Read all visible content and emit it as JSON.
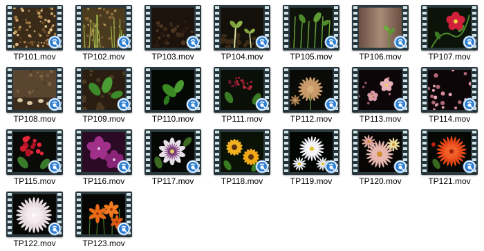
{
  "files": [
    {
      "name": "TP101.mov",
      "scene": "soil-seeds"
    },
    {
      "name": "TP102.mov",
      "scene": "sprouts-field"
    },
    {
      "name": "TP103.mov",
      "scene": "dark-soil"
    },
    {
      "name": "TP104.mov",
      "scene": "sprouts-dark"
    },
    {
      "name": "TP105.mov",
      "scene": "green-stems"
    },
    {
      "name": "TP106.mov",
      "scene": "bark-sprout"
    },
    {
      "name": "TP107.mov",
      "scene": "red-flower-vine"
    },
    {
      "name": "TP108.mov",
      "scene": "soil-mushrooms"
    },
    {
      "name": "TP109.mov",
      "scene": "leaves-soil"
    },
    {
      "name": "TP110.mov",
      "scene": "leaves-dark"
    },
    {
      "name": "TP111.mov",
      "scene": "raspberries"
    },
    {
      "name": "TP112.mov",
      "scene": "thistle-flower"
    },
    {
      "name": "TP113.mov",
      "scene": "pink-blossoms"
    },
    {
      "name": "TP114.mov",
      "scene": "pink-buds"
    },
    {
      "name": "TP115.mov",
      "scene": "red-geranium"
    },
    {
      "name": "TP116.mov",
      "scene": "purple-flowers"
    },
    {
      "name": "TP117.mov",
      "scene": "passion-flower"
    },
    {
      "name": "TP118.mov",
      "scene": "sunflowers"
    },
    {
      "name": "TP119.mov",
      "scene": "white-daisies"
    },
    {
      "name": "TP120.mov",
      "scene": "pink-daisies"
    },
    {
      "name": "TP121.mov",
      "scene": "orange-mum"
    },
    {
      "name": "TP122.mov",
      "scene": "white-chrysanthemum"
    },
    {
      "name": "TP123.mov",
      "scene": "orange-lilies"
    }
  ],
  "badge_icon": "quicktime-play-icon",
  "colors": {
    "film_frame": "#2c3a40",
    "sprocket_hole": "#cfe3e8",
    "badge_blue": "#2f7fd3",
    "label_text": "#000000",
    "background": "#ffffff"
  }
}
